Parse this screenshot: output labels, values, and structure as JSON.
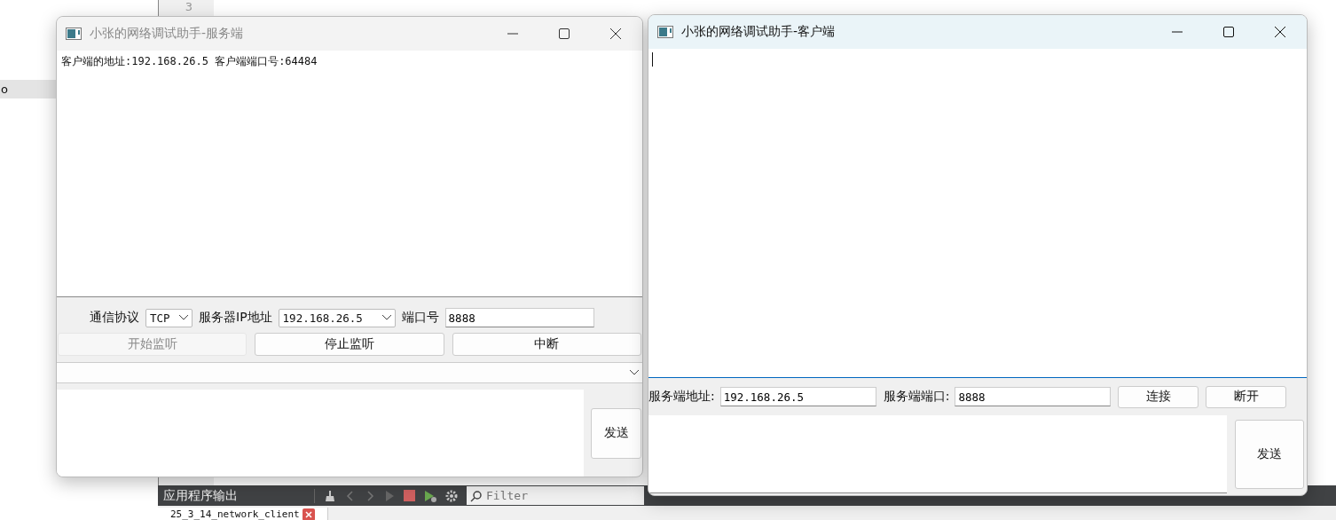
{
  "ide": {
    "sidebar_items": [
      {
        "label": "o",
        "selected": true
      }
    ],
    "line_numbers": [
      "3"
    ],
    "output_panel": {
      "title": "应用程序输出",
      "filter": {
        "placeholder": "Filter"
      },
      "tabs": [
        {
          "label": "25_3_14_network_client"
        }
      ]
    }
  },
  "server_window": {
    "title": "小张的网络调试助手-服务端",
    "active": false,
    "log": "客户端的地址:192.168.26.5 客户端端口号:64484",
    "protocol_label": "通信协议",
    "protocol": "TCP",
    "ip_label": "服务器IP地址",
    "ip": "192.168.26.5",
    "port_label": "端口号",
    "port": "8888",
    "buttons": [
      {
        "label": "开始监听",
        "disabled": true
      },
      {
        "label": "停止监听",
        "disabled": false
      },
      {
        "label": "中断",
        "disabled": false
      }
    ],
    "send_button": "发送"
  },
  "client_window": {
    "title": "小张的网络调试助手-客户端",
    "active": true,
    "address_label": "服务端地址:",
    "address": "192.168.26.5",
    "port_label": "服务端端口:",
    "port": "8888",
    "buttons": [
      {
        "label": "连接"
      },
      {
        "label": "断开"
      }
    ],
    "send_button": "发送"
  }
}
